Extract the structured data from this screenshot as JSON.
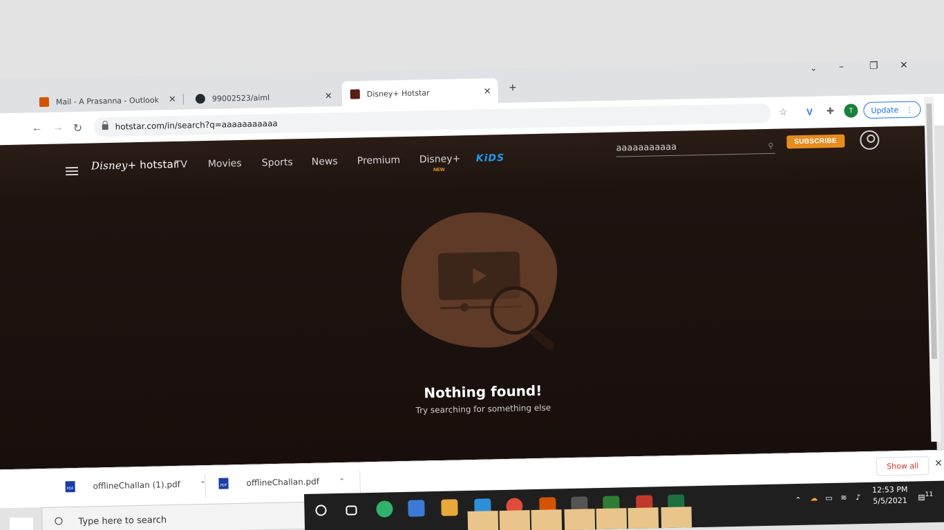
{
  "browser": {
    "tabs": [
      {
        "label": "Mail - A Prasanna - Outlook",
        "color": "#d35400"
      },
      {
        "label": "99002523/aiml",
        "color": "#24292e"
      },
      {
        "label": "Disney+ Hotstar",
        "color": "#5a1e12"
      }
    ],
    "new_tab": "+",
    "window_controls": {
      "minimize": "–",
      "restore": "❐",
      "close": "✕",
      "profile_menu": "⌄"
    },
    "url": "hotstar.com/in/search?q=aaaaaaaaaaa",
    "profile_initial": "T",
    "update_label": "Update"
  },
  "page": {
    "logo_disney": "Disney",
    "logo_hotstar": "+ hotstar",
    "nav": [
      "TV",
      "Movies",
      "Sports",
      "News",
      "Premium",
      "Disney+",
      "KiDS"
    ],
    "new_tag": "NEW",
    "search_value": "aaaaaaaaaaa",
    "subscribe_label": "SUBSCRIBE",
    "empty_title": "Nothing found!",
    "empty_subtitle": "Try searching for something else"
  },
  "downloads": {
    "items": [
      "offlineChallan (1).pdf",
      "offlineChallan.pdf"
    ],
    "pdf_badge": "PDF",
    "show_all": "Show all",
    "close": "✕"
  },
  "taskbar": {
    "search_placeholder": "Type here to search",
    "time": "12:53 PM",
    "date": "5/5/2021",
    "notification_count": "11"
  },
  "colors": {
    "accent_orange": "#e68c1f",
    "kids_blue": "#1f9bf0",
    "page_bg": "#1d1410"
  }
}
